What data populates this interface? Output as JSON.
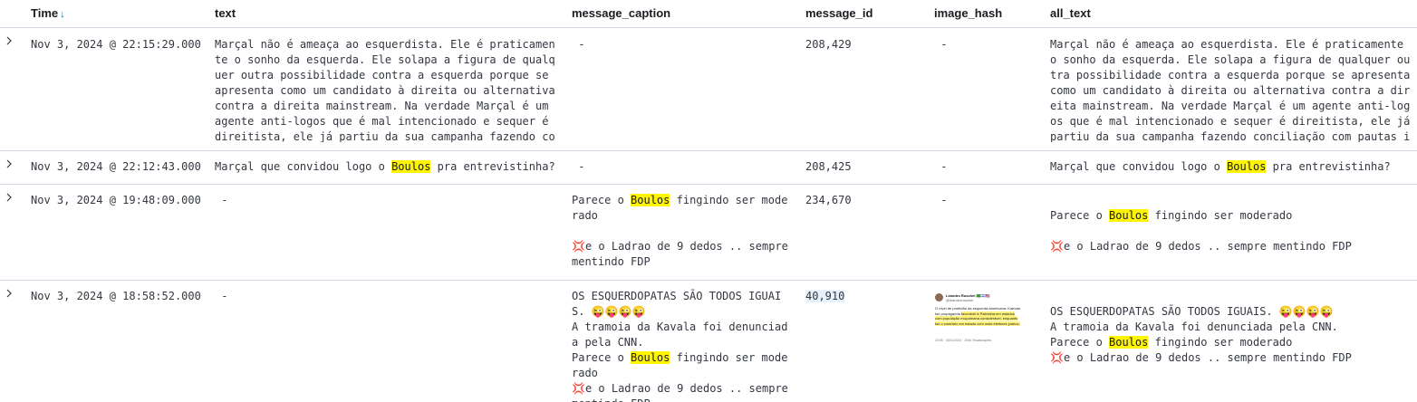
{
  "columns": {
    "time": "Time",
    "text": "text",
    "message_caption": "message_caption",
    "message_id": "message_id",
    "image_hash": "image_hash",
    "all_text": "all_text"
  },
  "highlight_term": "Boulos",
  "rows": [
    {
      "time": "Nov 3, 2024 @ 22:15:29.000",
      "text": "Marçal não é ameaça ao esquerdista. Ele é praticamente o sonho da esquerda. Ele solapa a figura de qualquer outra possibilidade contra a esquerda porque se apresenta como um candidato à direita ou alternativa contra a direita mainstream. Na verdade Marçal é um agente anti-logos que é mal intencionado e sequer é direitista, ele já partiu da sua campanha fazendo co",
      "message_caption": " -",
      "message_id": "208,429",
      "image_hash": " -",
      "all_text": "Marçal não é ameaça ao esquerdista. Ele é praticamente o sonho da esquerda. Ele solapa a figura de qualquer outra possibilidade contra a esquerda porque se apresenta como um candidato à direita ou alternativa contra a direita mainstream. Na verdade Marçal é um agente anti-logos que é mal intencionado e sequer é direitista, ele já partiu da sua campanha fazendo conciliação com pautas i"
    },
    {
      "time": "Nov 3, 2024 @ 22:12:43.000",
      "text": "Marçal que convidou logo o Boulos pra entrevistinha?",
      "message_caption": " -",
      "message_id": "208,425",
      "image_hash": " -",
      "all_text": "Marçal que convidou logo o Boulos pra entrevistinha?"
    },
    {
      "time": "Nov 3, 2024 @ 19:48:09.000",
      "text": " -",
      "message_caption": "Parece o Boulos fingindo ser moderado\n\n💢e o Ladrao de 9 dedos .. sempre mentindo FDP",
      "message_id": "234,670",
      "image_hash": " -",
      "all_text": "\nParece o Boulos fingindo ser moderado\n\n💢e o Ladrao de 9 dedos .. sempre mentindo FDP"
    },
    {
      "time": "Nov 3, 2024 @ 18:58:52.000",
      "text": " -",
      "message_caption": "OS ESQUERDOPATAS SÃO TODOS IGUAIS. 😜😜😜😜\nA tramoia da Kavala foi denunciada pela CNN.\nParece o Boulos fingindo ser moderado\n💢e o Ladrao de 9 dedos .. sempre mentindo FDP",
      "message_id": "40,910",
      "image_hash": "",
      "all_text": "\nOS ESQUERDOPATAS SÃO TODOS IGUAIS. 😜😜😜😜\nA tramoia da Kavala foi denunciada pela CNN.\nParece o Boulos fingindo ser moderado\n💢e o Ladrao de 9 dedos .. sempre mentindo FDP"
    }
  ],
  "thumbnail": {
    "author": "Leandro Ruschel 🇧🇷🇮🇱🇺🇸",
    "handle": "@leandroruschel",
    "body_before": "O nível de podridão da esquerda americana: Kamala faz propaganda ",
    "body_highlight": "favorável à Palestina em estados com população muçulmana considerável, enquanto faz o contrário em estado com mais eleitores judeus.",
    "footer": "10:55 · 03/11/2024 · 154k Visualizações"
  }
}
